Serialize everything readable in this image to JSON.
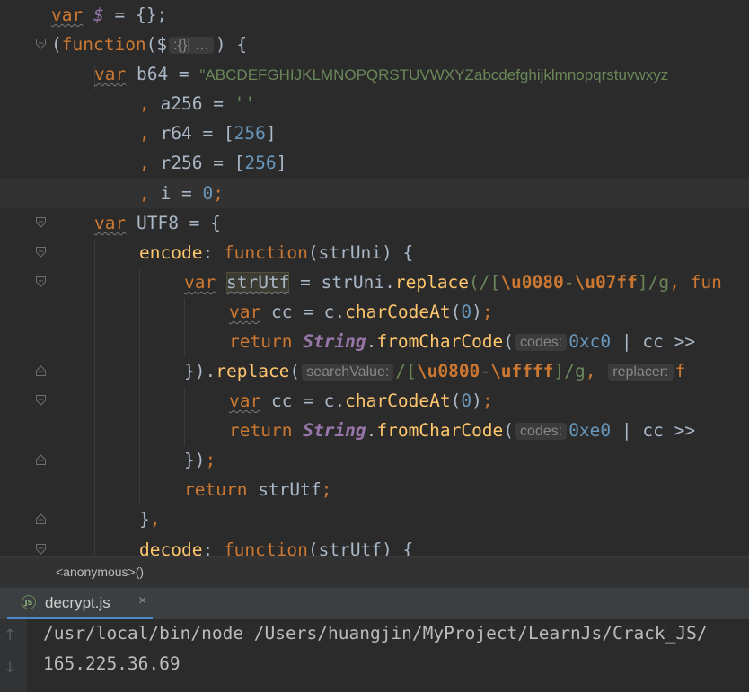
{
  "editor": {
    "lines": {
      "l1": {
        "kw_var": "var",
        "dollar": "$",
        "rest": " = {};"
      },
      "l2": {
        "open": "(",
        "kw_function": "function",
        "paren": "(",
        "dollar": "$",
        "hint": ":{}| …",
        "close": ") {"
      },
      "l3": {
        "kw_var": "var",
        "rest": " b64 = ",
        "str": "\"ABCDEFGHIJKLMNOPQRSTUVWXYZabcdefghijklmnopqrstuvwxyz"
      },
      "l4": {
        "comma": ",",
        "rest": " a256 = ",
        "str": "''"
      },
      "l5": {
        "comma": ",",
        "rest": " r64 = [",
        "num": "256",
        "end": "]"
      },
      "l6": {
        "comma": ",",
        "rest": " r256 = [",
        "num": "256",
        "end": "]"
      },
      "l7": {
        "comma": ",",
        "rest": " i = ",
        "num": "0",
        "semi": ";"
      },
      "l8": {
        "kw_var": "var",
        "rest": " UTF8 = {"
      },
      "l9": {
        "prop": "encode",
        "colon": ": ",
        "kw_function": "function",
        "rest": "(strUni) {"
      },
      "l10": {
        "kw_var": "var",
        "var_name": "strUtf",
        "rest1": " = strUni.",
        "method": "replace",
        "rx_open": "(/[",
        "esc1": "\\u0080",
        "dash": "-",
        "esc2": "\\u07ff",
        "rx_close": "]/g",
        "comma": ", ",
        "tail": "fun"
      },
      "l11": {
        "kw_var": "var",
        "rest1": " cc = c.",
        "method": "charCodeAt",
        "p1": "(",
        "num": "0",
        "p2": ")",
        "semi": ";"
      },
      "l12": {
        "kw_return": "return",
        "cls": "String",
        "dot": ".",
        "method": "fromCharCode",
        "p1": "(",
        "hint": "codes:",
        "num": "0xc0",
        "rest": " | cc >>"
      },
      "l13": {
        "start": "}).",
        "method": "replace",
        "p1": "(",
        "hint1": "searchValue:",
        "rx_open": "/[",
        "esc1": "\\u0800",
        "dash": "-",
        "esc2": "\\uffff",
        "rx_close": "]/g",
        "comma": ",",
        "hint2": "replacer:",
        "tail": "f"
      },
      "l14": {
        "kw_var": "var",
        "rest1": " cc = c.",
        "method": "charCodeAt",
        "p1": "(",
        "num": "0",
        "p2": ")",
        "semi": ";"
      },
      "l15": {
        "kw_return": "return",
        "cls": "String",
        "dot": ".",
        "method": "fromCharCode",
        "p1": "(",
        "hint": "codes:",
        "num": "0xe0",
        "rest": " | cc >>"
      },
      "l16": {
        "text": "})",
        "semi": ";"
      },
      "l17": {
        "kw_return": "return",
        "rest": " strUtf",
        "semi": ";"
      },
      "l18": {
        "text": "}",
        "comma": ","
      },
      "l19": {
        "prop": "decode",
        "colon": ": ",
        "kw_function": "function",
        "rest": "(strUtf) {"
      }
    }
  },
  "breadcrumb": {
    "text": "<anonymous>()"
  },
  "run_panel": {
    "tab_label": "decrypt.js",
    "tab_icon_text": "JS",
    "close_glyph": "×",
    "up_glyph": "↑",
    "down_glyph": "↓",
    "output": [
      "/usr/local/bin/node /Users/huangjin/MyProject/LearnJs/Crack_JS/",
      "165.225.36.69"
    ]
  },
  "colors": {
    "background": "#2b2b2b",
    "keyword": "#cc7832",
    "string": "#6a8759",
    "number": "#6897bb",
    "function": "#ffc66d",
    "class": "#9876aa",
    "tab_accent": "#4a88c7"
  }
}
